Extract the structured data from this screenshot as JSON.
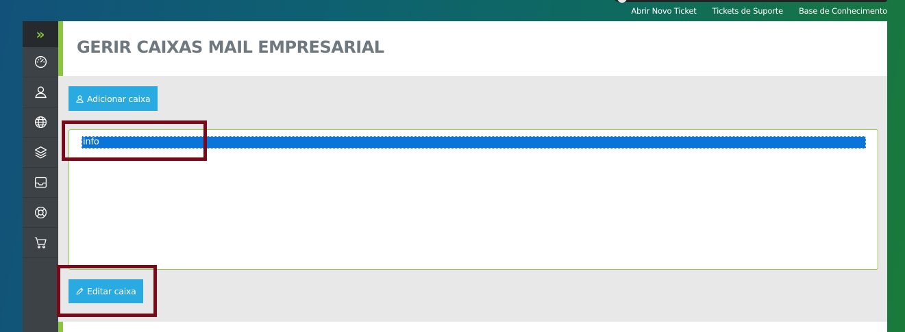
{
  "toplinks": [
    "Abrir Novo Ticket",
    "Tickets de Suporte",
    "Base de Conhecimento"
  ],
  "sidebar": {
    "toggle": "»",
    "items": [
      "dashboard-icon",
      "user-icon",
      "globe-icon",
      "layers-icon",
      "inbox-icon",
      "lifebuoy-icon",
      "cart-icon"
    ]
  },
  "page": {
    "title": "GERIR CAIXAS MAIL EMPRESARIAL",
    "add_button": "Adicionar caixa",
    "edit_button": "Editar caixa",
    "mailboxes": [
      "info"
    ]
  },
  "colors": {
    "accent": "#29abe2",
    "green": "#8cc63f",
    "sidebar": "#3d4246",
    "highlight": "#7a0a1a",
    "selection": "#0a74d8"
  }
}
